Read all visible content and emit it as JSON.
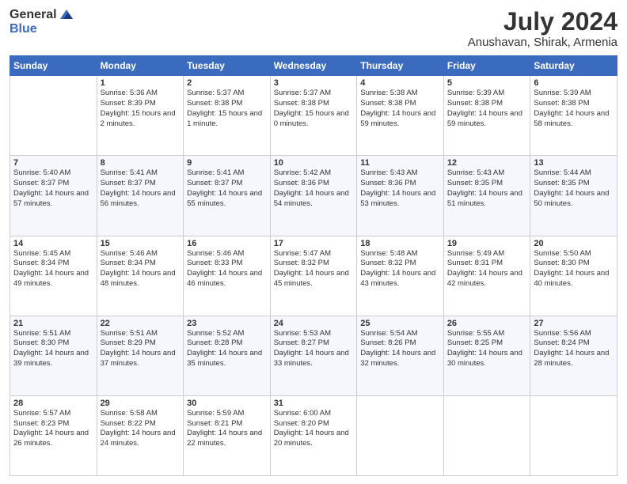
{
  "logo": {
    "general": "General",
    "blue": "Blue"
  },
  "title": "July 2024",
  "subtitle": "Anushavan, Shirak, Armenia",
  "headers": [
    "Sunday",
    "Monday",
    "Tuesday",
    "Wednesday",
    "Thursday",
    "Friday",
    "Saturday"
  ],
  "weeks": [
    [
      {
        "num": "",
        "sunrise": "",
        "sunset": "",
        "daylight": ""
      },
      {
        "num": "1",
        "sunrise": "Sunrise: 5:36 AM",
        "sunset": "Sunset: 8:39 PM",
        "daylight": "Daylight: 15 hours and 2 minutes."
      },
      {
        "num": "2",
        "sunrise": "Sunrise: 5:37 AM",
        "sunset": "Sunset: 8:38 PM",
        "daylight": "Daylight: 15 hours and 1 minute."
      },
      {
        "num": "3",
        "sunrise": "Sunrise: 5:37 AM",
        "sunset": "Sunset: 8:38 PM",
        "daylight": "Daylight: 15 hours and 0 minutes."
      },
      {
        "num": "4",
        "sunrise": "Sunrise: 5:38 AM",
        "sunset": "Sunset: 8:38 PM",
        "daylight": "Daylight: 14 hours and 59 minutes."
      },
      {
        "num": "5",
        "sunrise": "Sunrise: 5:39 AM",
        "sunset": "Sunset: 8:38 PM",
        "daylight": "Daylight: 14 hours and 59 minutes."
      },
      {
        "num": "6",
        "sunrise": "Sunrise: 5:39 AM",
        "sunset": "Sunset: 8:38 PM",
        "daylight": "Daylight: 14 hours and 58 minutes."
      }
    ],
    [
      {
        "num": "7",
        "sunrise": "Sunrise: 5:40 AM",
        "sunset": "Sunset: 8:37 PM",
        "daylight": "Daylight: 14 hours and 57 minutes."
      },
      {
        "num": "8",
        "sunrise": "Sunrise: 5:41 AM",
        "sunset": "Sunset: 8:37 PM",
        "daylight": "Daylight: 14 hours and 56 minutes."
      },
      {
        "num": "9",
        "sunrise": "Sunrise: 5:41 AM",
        "sunset": "Sunset: 8:37 PM",
        "daylight": "Daylight: 14 hours and 55 minutes."
      },
      {
        "num": "10",
        "sunrise": "Sunrise: 5:42 AM",
        "sunset": "Sunset: 8:36 PM",
        "daylight": "Daylight: 14 hours and 54 minutes."
      },
      {
        "num": "11",
        "sunrise": "Sunrise: 5:43 AM",
        "sunset": "Sunset: 8:36 PM",
        "daylight": "Daylight: 14 hours and 53 minutes."
      },
      {
        "num": "12",
        "sunrise": "Sunrise: 5:43 AM",
        "sunset": "Sunset: 8:35 PM",
        "daylight": "Daylight: 14 hours and 51 minutes."
      },
      {
        "num": "13",
        "sunrise": "Sunrise: 5:44 AM",
        "sunset": "Sunset: 8:35 PM",
        "daylight": "Daylight: 14 hours and 50 minutes."
      }
    ],
    [
      {
        "num": "14",
        "sunrise": "Sunrise: 5:45 AM",
        "sunset": "Sunset: 8:34 PM",
        "daylight": "Daylight: 14 hours and 49 minutes."
      },
      {
        "num": "15",
        "sunrise": "Sunrise: 5:46 AM",
        "sunset": "Sunset: 8:34 PM",
        "daylight": "Daylight: 14 hours and 48 minutes."
      },
      {
        "num": "16",
        "sunrise": "Sunrise: 5:46 AM",
        "sunset": "Sunset: 8:33 PM",
        "daylight": "Daylight: 14 hours and 46 minutes."
      },
      {
        "num": "17",
        "sunrise": "Sunrise: 5:47 AM",
        "sunset": "Sunset: 8:32 PM",
        "daylight": "Daylight: 14 hours and 45 minutes."
      },
      {
        "num": "18",
        "sunrise": "Sunrise: 5:48 AM",
        "sunset": "Sunset: 8:32 PM",
        "daylight": "Daylight: 14 hours and 43 minutes."
      },
      {
        "num": "19",
        "sunrise": "Sunrise: 5:49 AM",
        "sunset": "Sunset: 8:31 PM",
        "daylight": "Daylight: 14 hours and 42 minutes."
      },
      {
        "num": "20",
        "sunrise": "Sunrise: 5:50 AM",
        "sunset": "Sunset: 8:30 PM",
        "daylight": "Daylight: 14 hours and 40 minutes."
      }
    ],
    [
      {
        "num": "21",
        "sunrise": "Sunrise: 5:51 AM",
        "sunset": "Sunset: 8:30 PM",
        "daylight": "Daylight: 14 hours and 39 minutes."
      },
      {
        "num": "22",
        "sunrise": "Sunrise: 5:51 AM",
        "sunset": "Sunset: 8:29 PM",
        "daylight": "Daylight: 14 hours and 37 minutes."
      },
      {
        "num": "23",
        "sunrise": "Sunrise: 5:52 AM",
        "sunset": "Sunset: 8:28 PM",
        "daylight": "Daylight: 14 hours and 35 minutes."
      },
      {
        "num": "24",
        "sunrise": "Sunrise: 5:53 AM",
        "sunset": "Sunset: 8:27 PM",
        "daylight": "Daylight: 14 hours and 33 minutes."
      },
      {
        "num": "25",
        "sunrise": "Sunrise: 5:54 AM",
        "sunset": "Sunset: 8:26 PM",
        "daylight": "Daylight: 14 hours and 32 minutes."
      },
      {
        "num": "26",
        "sunrise": "Sunrise: 5:55 AM",
        "sunset": "Sunset: 8:25 PM",
        "daylight": "Daylight: 14 hours and 30 minutes."
      },
      {
        "num": "27",
        "sunrise": "Sunrise: 5:56 AM",
        "sunset": "Sunset: 8:24 PM",
        "daylight": "Daylight: 14 hours and 28 minutes."
      }
    ],
    [
      {
        "num": "28",
        "sunrise": "Sunrise: 5:57 AM",
        "sunset": "Sunset: 8:23 PM",
        "daylight": "Daylight: 14 hours and 26 minutes."
      },
      {
        "num": "29",
        "sunrise": "Sunrise: 5:58 AM",
        "sunset": "Sunset: 8:22 PM",
        "daylight": "Daylight: 14 hours and 24 minutes."
      },
      {
        "num": "30",
        "sunrise": "Sunrise: 5:59 AM",
        "sunset": "Sunset: 8:21 PM",
        "daylight": "Daylight: 14 hours and 22 minutes."
      },
      {
        "num": "31",
        "sunrise": "Sunrise: 6:00 AM",
        "sunset": "Sunset: 8:20 PM",
        "daylight": "Daylight: 14 hours and 20 minutes."
      },
      {
        "num": "",
        "sunrise": "",
        "sunset": "",
        "daylight": ""
      },
      {
        "num": "",
        "sunrise": "",
        "sunset": "",
        "daylight": ""
      },
      {
        "num": "",
        "sunrise": "",
        "sunset": "",
        "daylight": ""
      }
    ]
  ]
}
